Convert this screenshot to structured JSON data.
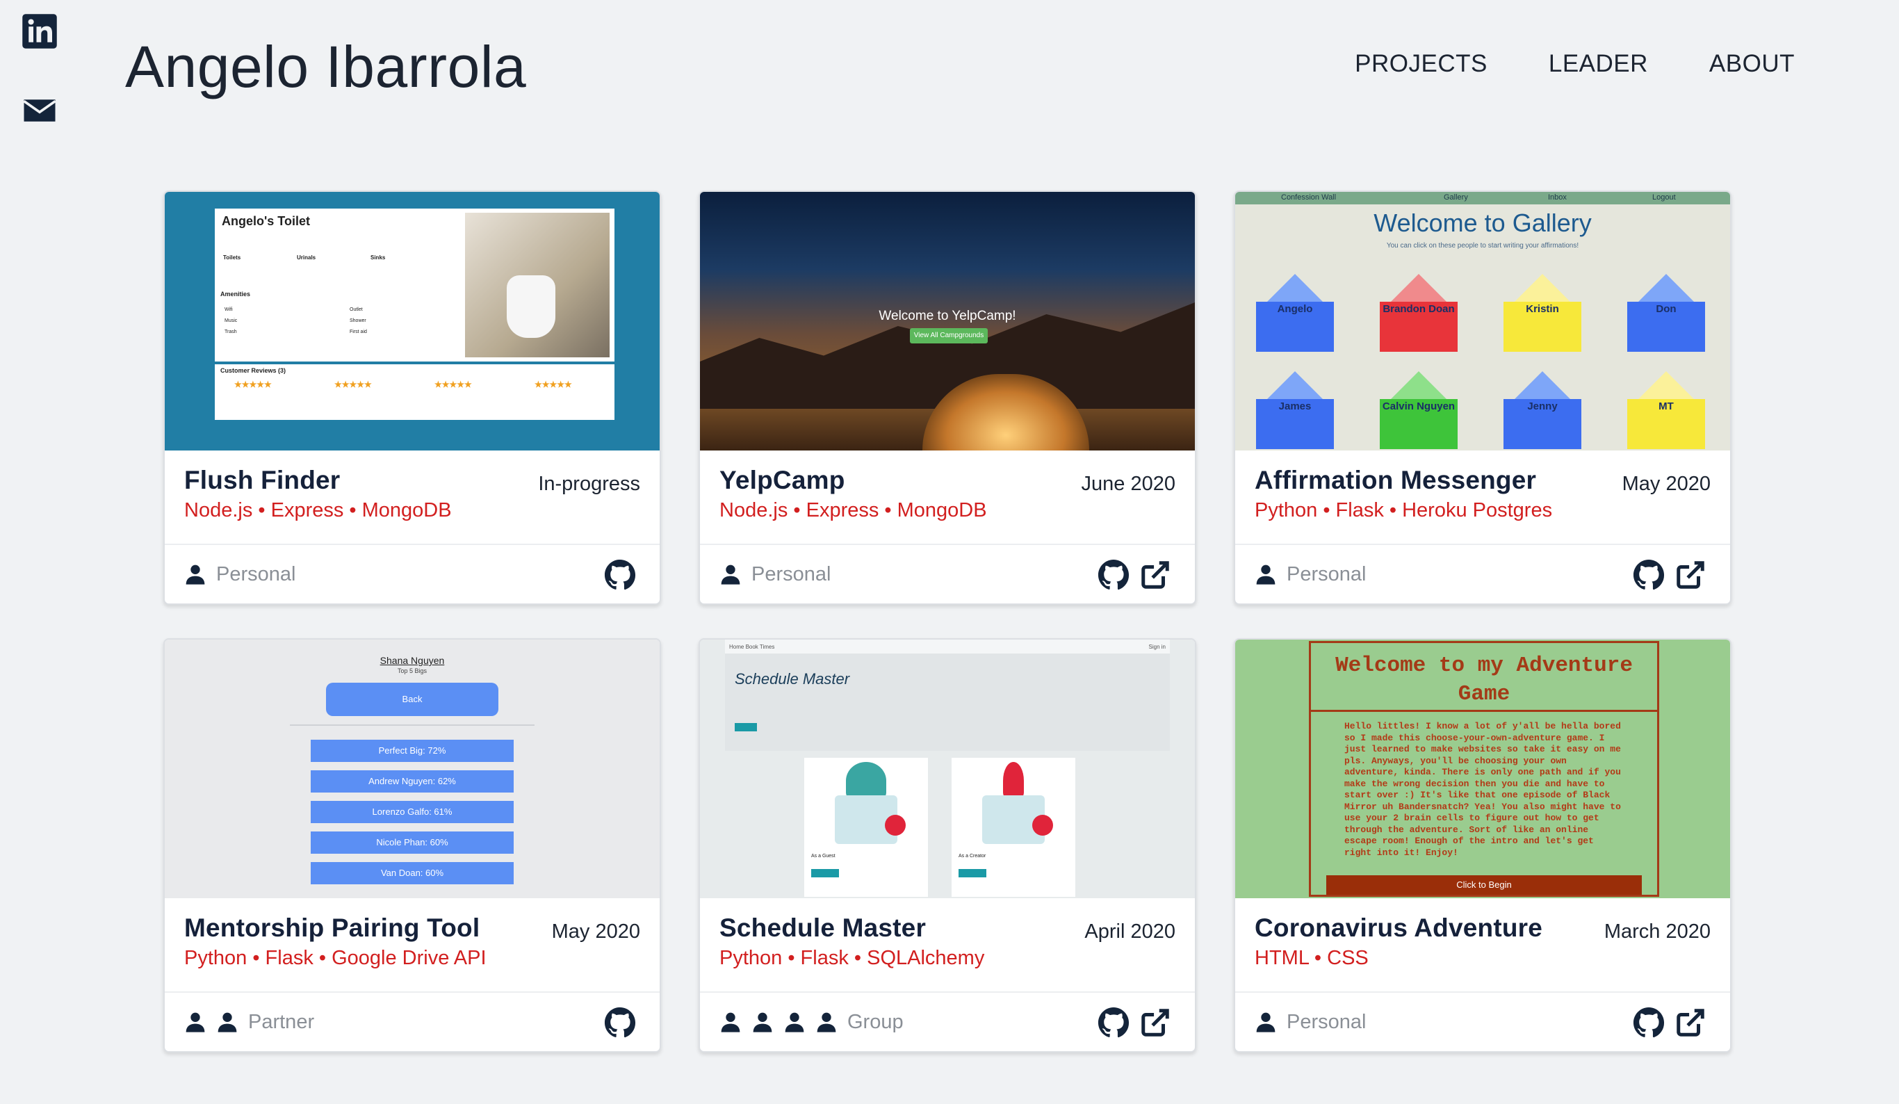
{
  "header": {
    "title": "Angelo Ibarrola",
    "nav": [
      "PROJECTS",
      "LEADER",
      "ABOUT"
    ]
  },
  "side_icons": [
    "linkedin-icon",
    "envelope-icon"
  ],
  "colors": {
    "accent_red": "#d21f1f",
    "heading": "#15213a",
    "muted": "#8a8f96"
  },
  "projects": [
    {
      "name": "Flush Finder",
      "date": "In-progress",
      "tech": "Node.js • Express • MongoDB",
      "kind": "Personal",
      "people": 1,
      "links": [
        "github-icon"
      ],
      "thumb": {
        "title": "Angelo's Toilet",
        "sections": [
          "Amenities",
          "Customer Reviews (3)"
        ],
        "stalls": [
          "Toilets",
          "Urinals",
          "Sinks"
        ],
        "amenities": [
          "Wifi",
          "Outlet",
          "Music",
          "Shower",
          "Trash",
          "First aid"
        ]
      }
    },
    {
      "name": "YelpCamp",
      "date": "June 2020",
      "tech": "Node.js • Express • MongoDB",
      "kind": "Personal",
      "people": 1,
      "links": [
        "github-icon",
        "external-link-icon"
      ],
      "thumb": {
        "headline": "Welcome to YelpCamp!",
        "button": "View All Campgrounds"
      }
    },
    {
      "name": "Affirmation Messenger",
      "date": "May 2020",
      "tech": "Python • Flask • Heroku Postgres",
      "kind": "Personal",
      "people": 1,
      "links": [
        "github-icon",
        "external-link-icon"
      ],
      "thumb": {
        "nav": [
          "Confession Wall",
          "Gallery",
          "Inbox",
          "Logout"
        ],
        "title": "Welcome to Gallery",
        "subtitle": "You can click on these people to start writing your affirmations!",
        "envelopes": [
          {
            "name": "Angelo",
            "color": "#3c6df0"
          },
          {
            "name": "Brandon Doan",
            "color": "#e8343a"
          },
          {
            "name": "Kristin",
            "color": "#f7e83a"
          },
          {
            "name": "Don",
            "color": "#3c6df0"
          },
          {
            "name": "James",
            "color": "#3c6df0"
          },
          {
            "name": "Calvin Nguyen",
            "color": "#3ec43a"
          },
          {
            "name": "Jenny",
            "color": "#3c6df0"
          },
          {
            "name": "MT",
            "color": "#f7e83a"
          }
        ]
      }
    },
    {
      "name": "Mentorship Pairing Tool",
      "date": "May 2020",
      "tech": "Python • Flask • Google Drive API",
      "kind": "Partner",
      "people": 2,
      "links": [
        "github-icon"
      ],
      "thumb": {
        "name": "Shana Nguyen",
        "subtitle": "Top 5 Bigs",
        "back": "Back",
        "rows": [
          "Perfect Big: 72%",
          "Andrew Nguyen: 62%",
          "Lorenzo Galfo: 61%",
          "Nicole Phan: 60%",
          "Van Doan: 60%"
        ]
      }
    },
    {
      "name": "Schedule Master",
      "date": "April 2020",
      "tech": "Python • Flask • SQLAlchemy",
      "kind": "Group",
      "people": 4,
      "links": [
        "github-icon",
        "external-link-icon"
      ],
      "thumb": {
        "nav": "Home   Book Times",
        "signin": "Sign in",
        "title": "Schedule Master",
        "panes": [
          "As a Guest",
          "As a Creator"
        ]
      }
    },
    {
      "name": "Coronavirus Adventure",
      "date": "March 2020",
      "tech": "HTML • CSS",
      "kind": "Personal",
      "people": 1,
      "links": [
        "github-icon",
        "external-link-icon"
      ],
      "thumb": {
        "title": "Welcome to my Adventure Game",
        "text": "Hello littles! I know a lot of y'all be hella bored so I made this choose-your-own-adventure game. I just learned to make websites so take it easy on me pls. Anyways, you'll be choosing your own adventure, kinda. There is only one path and if you make the wrong decision then you die and have to start over :) It's like that one episode of Black Mirror uh Bandersnatch? Yea! You also might have to use your 2 brain cells to figure out how to get through the adventure. Sort of like an online escape room! Enough of the intro and let's get right into it! Enjoy!",
        "button": "Click to Begin"
      }
    }
  ]
}
